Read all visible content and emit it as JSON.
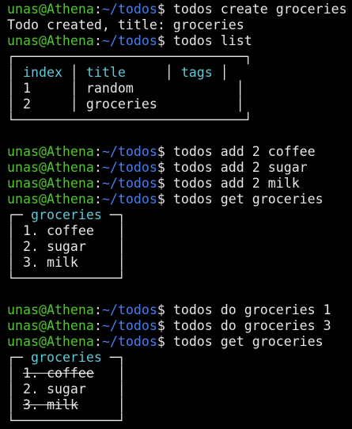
{
  "prompt": {
    "user": "unas@Athena",
    "sep": ":",
    "path": "~/todos",
    "symbol": "$"
  },
  "commands": {
    "create": " todos create groceries",
    "list": " todos list",
    "add1": " todos add 2 coffee",
    "add2": " todos add 2 sugar",
    "add3": " todos add 2 milk",
    "get1": " todos get groceries",
    "do1": " todos do groceries 1",
    "do2": " todos do groceries 3",
    "get2": " todos get groceries"
  },
  "outputs": {
    "created": "Todo created, title: groceries"
  },
  "list_table": {
    "headers": [
      "index",
      "title",
      "tags"
    ],
    "rows": [
      {
        "index": "1",
        "title": "random",
        "tags": ""
      },
      {
        "index": "2",
        "title": "groceries",
        "tags": ""
      }
    ]
  },
  "groceries_before": {
    "title": "groceries",
    "items": [
      "1. coffee",
      "2. sugar",
      "3. milk"
    ]
  },
  "groceries_after": {
    "title": "groceries",
    "items": [
      {
        "text": "1. coffee",
        "done": true
      },
      {
        "text": "2. sugar",
        "done": false
      },
      {
        "text": "3. milk",
        "done": true
      }
    ]
  },
  "colors": {
    "background": "#000000",
    "user": "#4ec72e",
    "path": "#4a7cf0",
    "accent": "#5fc9d6",
    "text": "#e6e6e6"
  }
}
